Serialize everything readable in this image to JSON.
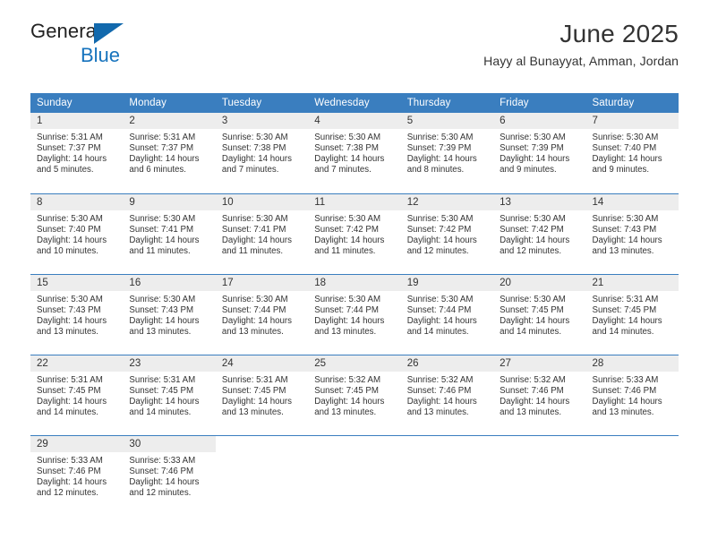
{
  "brand": {
    "name_part1": "General",
    "name_part2": "Blue",
    "triangle_color": "#1269ad"
  },
  "header": {
    "title": "June 2025",
    "subtitle": "Hayy al Bunayyat, Amman, Jordan",
    "accent_color": "#3a7ebf",
    "daynum_background": "#ededed"
  },
  "calendar": {
    "weekday_headers": [
      "Sunday",
      "Monday",
      "Tuesday",
      "Wednesday",
      "Thursday",
      "Friday",
      "Saturday"
    ],
    "weeks": [
      [
        {
          "day": "1",
          "sunrise": "Sunrise: 5:31 AM",
          "sunset": "Sunset: 7:37 PM",
          "daylight_line1": "Daylight: 14 hours",
          "daylight_line2": "and 5 minutes."
        },
        {
          "day": "2",
          "sunrise": "Sunrise: 5:31 AM",
          "sunset": "Sunset: 7:37 PM",
          "daylight_line1": "Daylight: 14 hours",
          "daylight_line2": "and 6 minutes."
        },
        {
          "day": "3",
          "sunrise": "Sunrise: 5:30 AM",
          "sunset": "Sunset: 7:38 PM",
          "daylight_line1": "Daylight: 14 hours",
          "daylight_line2": "and 7 minutes."
        },
        {
          "day": "4",
          "sunrise": "Sunrise: 5:30 AM",
          "sunset": "Sunset: 7:38 PM",
          "daylight_line1": "Daylight: 14 hours",
          "daylight_line2": "and 7 minutes."
        },
        {
          "day": "5",
          "sunrise": "Sunrise: 5:30 AM",
          "sunset": "Sunset: 7:39 PM",
          "daylight_line1": "Daylight: 14 hours",
          "daylight_line2": "and 8 minutes."
        },
        {
          "day": "6",
          "sunrise": "Sunrise: 5:30 AM",
          "sunset": "Sunset: 7:39 PM",
          "daylight_line1": "Daylight: 14 hours",
          "daylight_line2": "and 9 minutes."
        },
        {
          "day": "7",
          "sunrise": "Sunrise: 5:30 AM",
          "sunset": "Sunset: 7:40 PM",
          "daylight_line1": "Daylight: 14 hours",
          "daylight_line2": "and 9 minutes."
        }
      ],
      [
        {
          "day": "8",
          "sunrise": "Sunrise: 5:30 AM",
          "sunset": "Sunset: 7:40 PM",
          "daylight_line1": "Daylight: 14 hours",
          "daylight_line2": "and 10 minutes."
        },
        {
          "day": "9",
          "sunrise": "Sunrise: 5:30 AM",
          "sunset": "Sunset: 7:41 PM",
          "daylight_line1": "Daylight: 14 hours",
          "daylight_line2": "and 11 minutes."
        },
        {
          "day": "10",
          "sunrise": "Sunrise: 5:30 AM",
          "sunset": "Sunset: 7:41 PM",
          "daylight_line1": "Daylight: 14 hours",
          "daylight_line2": "and 11 minutes."
        },
        {
          "day": "11",
          "sunrise": "Sunrise: 5:30 AM",
          "sunset": "Sunset: 7:42 PM",
          "daylight_line1": "Daylight: 14 hours",
          "daylight_line2": "and 11 minutes."
        },
        {
          "day": "12",
          "sunrise": "Sunrise: 5:30 AM",
          "sunset": "Sunset: 7:42 PM",
          "daylight_line1": "Daylight: 14 hours",
          "daylight_line2": "and 12 minutes."
        },
        {
          "day": "13",
          "sunrise": "Sunrise: 5:30 AM",
          "sunset": "Sunset: 7:42 PM",
          "daylight_line1": "Daylight: 14 hours",
          "daylight_line2": "and 12 minutes."
        },
        {
          "day": "14",
          "sunrise": "Sunrise: 5:30 AM",
          "sunset": "Sunset: 7:43 PM",
          "daylight_line1": "Daylight: 14 hours",
          "daylight_line2": "and 13 minutes."
        }
      ],
      [
        {
          "day": "15",
          "sunrise": "Sunrise: 5:30 AM",
          "sunset": "Sunset: 7:43 PM",
          "daylight_line1": "Daylight: 14 hours",
          "daylight_line2": "and 13 minutes."
        },
        {
          "day": "16",
          "sunrise": "Sunrise: 5:30 AM",
          "sunset": "Sunset: 7:43 PM",
          "daylight_line1": "Daylight: 14 hours",
          "daylight_line2": "and 13 minutes."
        },
        {
          "day": "17",
          "sunrise": "Sunrise: 5:30 AM",
          "sunset": "Sunset: 7:44 PM",
          "daylight_line1": "Daylight: 14 hours",
          "daylight_line2": "and 13 minutes."
        },
        {
          "day": "18",
          "sunrise": "Sunrise: 5:30 AM",
          "sunset": "Sunset: 7:44 PM",
          "daylight_line1": "Daylight: 14 hours",
          "daylight_line2": "and 13 minutes."
        },
        {
          "day": "19",
          "sunrise": "Sunrise: 5:30 AM",
          "sunset": "Sunset: 7:44 PM",
          "daylight_line1": "Daylight: 14 hours",
          "daylight_line2": "and 14 minutes."
        },
        {
          "day": "20",
          "sunrise": "Sunrise: 5:30 AM",
          "sunset": "Sunset: 7:45 PM",
          "daylight_line1": "Daylight: 14 hours",
          "daylight_line2": "and 14 minutes."
        },
        {
          "day": "21",
          "sunrise": "Sunrise: 5:31 AM",
          "sunset": "Sunset: 7:45 PM",
          "daylight_line1": "Daylight: 14 hours",
          "daylight_line2": "and 14 minutes."
        }
      ],
      [
        {
          "day": "22",
          "sunrise": "Sunrise: 5:31 AM",
          "sunset": "Sunset: 7:45 PM",
          "daylight_line1": "Daylight: 14 hours",
          "daylight_line2": "and 14 minutes."
        },
        {
          "day": "23",
          "sunrise": "Sunrise: 5:31 AM",
          "sunset": "Sunset: 7:45 PM",
          "daylight_line1": "Daylight: 14 hours",
          "daylight_line2": "and 14 minutes."
        },
        {
          "day": "24",
          "sunrise": "Sunrise: 5:31 AM",
          "sunset": "Sunset: 7:45 PM",
          "daylight_line1": "Daylight: 14 hours",
          "daylight_line2": "and 13 minutes."
        },
        {
          "day": "25",
          "sunrise": "Sunrise: 5:32 AM",
          "sunset": "Sunset: 7:45 PM",
          "daylight_line1": "Daylight: 14 hours",
          "daylight_line2": "and 13 minutes."
        },
        {
          "day": "26",
          "sunrise": "Sunrise: 5:32 AM",
          "sunset": "Sunset: 7:46 PM",
          "daylight_line1": "Daylight: 14 hours",
          "daylight_line2": "and 13 minutes."
        },
        {
          "day": "27",
          "sunrise": "Sunrise: 5:32 AM",
          "sunset": "Sunset: 7:46 PM",
          "daylight_line1": "Daylight: 14 hours",
          "daylight_line2": "and 13 minutes."
        },
        {
          "day": "28",
          "sunrise": "Sunrise: 5:33 AM",
          "sunset": "Sunset: 7:46 PM",
          "daylight_line1": "Daylight: 14 hours",
          "daylight_line2": "and 13 minutes."
        }
      ],
      [
        {
          "day": "29",
          "sunrise": "Sunrise: 5:33 AM",
          "sunset": "Sunset: 7:46 PM",
          "daylight_line1": "Daylight: 14 hours",
          "daylight_line2": "and 12 minutes."
        },
        {
          "day": "30",
          "sunrise": "Sunrise: 5:33 AM",
          "sunset": "Sunset: 7:46 PM",
          "daylight_line1": "Daylight: 14 hours",
          "daylight_line2": "and 12 minutes."
        },
        {
          "day": "",
          "sunrise": "",
          "sunset": "",
          "daylight_line1": "",
          "daylight_line2": ""
        },
        {
          "day": "",
          "sunrise": "",
          "sunset": "",
          "daylight_line1": "",
          "daylight_line2": ""
        },
        {
          "day": "",
          "sunrise": "",
          "sunset": "",
          "daylight_line1": "",
          "daylight_line2": ""
        },
        {
          "day": "",
          "sunrise": "",
          "sunset": "",
          "daylight_line1": "",
          "daylight_line2": ""
        },
        {
          "day": "",
          "sunrise": "",
          "sunset": "",
          "daylight_line1": "",
          "daylight_line2": ""
        }
      ]
    ]
  }
}
